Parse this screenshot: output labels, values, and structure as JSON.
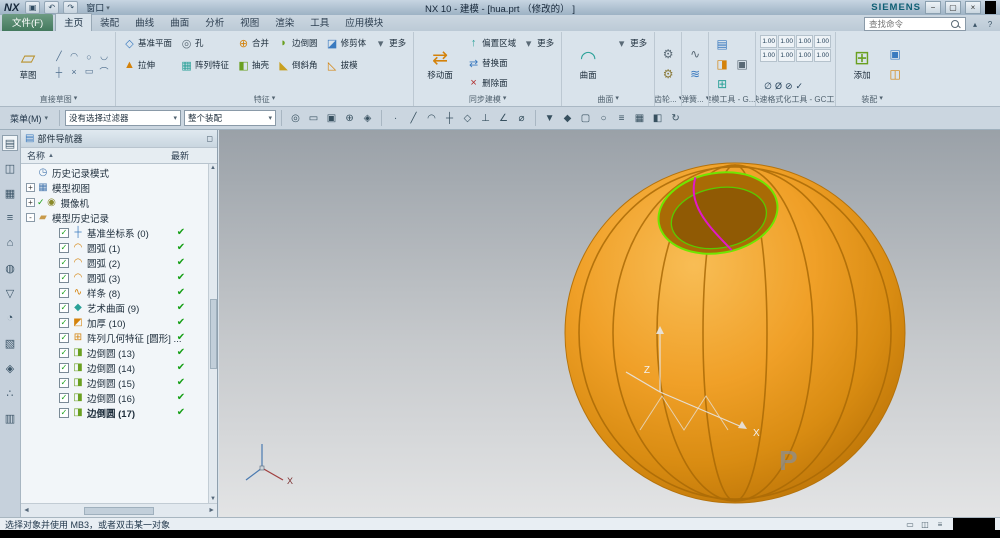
{
  "ui": {
    "caret_down": "▾",
    "caret_up": "▲",
    "arrow_left": "◄",
    "arrow_right": "►",
    "scroll_up": "▲",
    "scroll_down": "▼"
  },
  "title_bar": {
    "logo": "NX",
    "icons": [
      "▣",
      "↶",
      "↷"
    ],
    "window_menu": "窗口",
    "title": "NX 10 - 建模 - [hua.prt （修改的） ]",
    "brand": "SIEMENS",
    "win_buttons": [
      "−",
      "▢",
      "×"
    ]
  },
  "tabs": {
    "file": "文件(F)",
    "items": [
      {
        "label": "主页",
        "active": true
      },
      {
        "label": "装配"
      },
      {
        "label": "曲线"
      },
      {
        "label": "曲面"
      },
      {
        "label": "分析"
      },
      {
        "label": "视图"
      },
      {
        "label": "渲染"
      },
      {
        "label": "工具"
      },
      {
        "label": "应用模块"
      }
    ],
    "search_placeholder": "查找命令",
    "right_icons": [
      "▴",
      "?"
    ]
  },
  "ribbon": {
    "sketch": {
      "label": "直接草图",
      "big": {
        "label": "草图",
        "glyph": "▱",
        "color": "#b8902a"
      },
      "mini": [
        "╱",
        "◠",
        "○",
        "◡",
        "┼",
        "×",
        "▭",
        "⌒"
      ]
    },
    "feature": {
      "label": "特征",
      "buttons": [
        {
          "label": "基准平面",
          "glyph": "◇",
          "color": "#3a7abf"
        },
        {
          "label": "拉伸",
          "glyph": "▲",
          "color": "#d4820a"
        },
        {
          "label": "孔",
          "glyph": "◎",
          "color": "#5a6a76"
        },
        {
          "label": "阵列特征",
          "glyph": "▦",
          "color": "#2aa198"
        },
        {
          "label": "合并",
          "glyph": "⊕",
          "color": "#d4820a"
        },
        {
          "label": "抽壳",
          "glyph": "◧",
          "color": "#6aa020"
        },
        {
          "label": "边倒圆",
          "glyph": "◗",
          "color": "#6aa020"
        },
        {
          "label": "倒斜角",
          "glyph": "◣",
          "color": "#c8a020"
        },
        {
          "label": "修剪体",
          "glyph": "◪",
          "color": "#3a7abf"
        },
        {
          "label": "拔模",
          "glyph": "◺",
          "color": "#d4820a"
        },
        {
          "label": "更多",
          "glyph": "▾",
          "color": "#5a6a76"
        }
      ]
    },
    "sync": {
      "label": "同步建模",
      "big": {
        "label": "移动面",
        "glyph": "⇄",
        "color": "#d4820a"
      },
      "buttons": [
        {
          "label": "偏置区域",
          "glyph": "↑",
          "color": "#2aa198"
        },
        {
          "label": "替换面",
          "glyph": "⇄",
          "color": "#3a7abf"
        },
        {
          "label": "删除面",
          "glyph": "×",
          "color": "#b03030"
        },
        {
          "label": "更多",
          "glyph": "▾",
          "color": "#5a6a76"
        }
      ]
    },
    "surface": {
      "label": "曲面",
      "big": {
        "label": "曲面",
        "glyph": "◠",
        "color": "#2aa198"
      },
      "buttons": [
        {
          "label": "更多",
          "glyph": "▾",
          "color": "#5a6a76"
        }
      ]
    },
    "gear": {
      "label": "齿轮...",
      "icons": [
        {
          "glyph": "⚙",
          "color": "#5a6a76"
        },
        {
          "glyph": "⚙",
          "color": "#8a7a3a"
        }
      ]
    },
    "spring": {
      "label": "弹簧...",
      "icons": [
        {
          "glyph": "∿",
          "color": "#5a6a76"
        },
        {
          "glyph": "≋",
          "color": "#3a7abf"
        }
      ]
    },
    "gctools": {
      "label": "建模工具 - G...",
      "icons": [
        {
          "glyph": "▤",
          "color": "#3a7abf"
        },
        {
          "glyph": "◨",
          "color": "#d4820a"
        },
        {
          "glyph": "⊞",
          "color": "#2aa198"
        },
        {
          "glyph": "▣",
          "color": "#5a6a76"
        }
      ]
    },
    "dims": {
      "label": "尺寸快速格式化工具 - GC工具箱",
      "cells": [
        "1.00",
        "1.00",
        "1.00",
        "1.00",
        "1.00",
        "1.00",
        "1.00",
        "1.00"
      ],
      "syms": [
        "∅",
        "Ø",
        "⊘",
        "✓"
      ]
    },
    "asm": {
      "label": "装配",
      "big": {
        "label": "添加",
        "glyph": "⊞",
        "color": "#6aa020"
      },
      "icons": [
        {
          "glyph": "▣",
          "color": "#3a7abf"
        },
        {
          "glyph": "◫",
          "color": "#d4820a"
        }
      ]
    }
  },
  "selbar": {
    "menu": "菜单(M)",
    "filter": "没有选择过滤器",
    "scope": "整个装配",
    "c1": [
      "◎",
      "▭",
      "▣",
      "⊕",
      "◈"
    ],
    "c2": [
      "∙",
      "╱",
      "◠",
      "┼",
      "◇",
      "⊥",
      "∠",
      "⌀"
    ],
    "c3": [
      "▼",
      "◆",
      "▢",
      "○",
      "≡",
      "▦",
      "◧",
      "↻"
    ]
  },
  "leftstrip": {
    "icons": [
      {
        "glyph": "▤",
        "active": true
      },
      {
        "glyph": "◫"
      },
      {
        "glyph": "▦"
      },
      {
        "glyph": "≡"
      },
      {
        "glyph": "⌂"
      },
      {
        "glyph": "◍"
      },
      {
        "glyph": "▽"
      },
      {
        "glyph": "◔"
      },
      {
        "glyph": "▧"
      },
      {
        "glyph": "◈"
      },
      {
        "glyph": "∴"
      },
      {
        "glyph": "▥"
      }
    ]
  },
  "navigator": {
    "title": "部件导航器",
    "title_btn": "◻",
    "col_name": "名称",
    "col_sort": "▲",
    "col_latest": "最新",
    "check_glyph": "✓",
    "items": [
      {
        "glyph": "◷",
        "color": "#4a7ab0",
        "label": "历史记录模式"
      },
      {
        "expander": "+",
        "glyph": "▦",
        "color": "#4a7ab0",
        "label": "模型视图"
      },
      {
        "expander": "+",
        "precheck": true,
        "glyph": "◉",
        "color": "#8a8a2a",
        "label": "摄像机"
      },
      {
        "expander": "-",
        "glyph": "▰",
        "color": "#c89a4a",
        "label": "模型历史记录"
      },
      {
        "level": 1,
        "checkbox": true,
        "glyph": "┼",
        "color": "#3a7abf",
        "label": "基准坐标系 (0)",
        "latest": "✔"
      },
      {
        "level": 1,
        "checkbox": true,
        "glyph": "◠",
        "color": "#d4820a",
        "label": "圆弧 (1)",
        "latest": "✔"
      },
      {
        "level": 1,
        "checkbox": true,
        "glyph": "◠",
        "color": "#d4820a",
        "label": "圆弧 (2)",
        "latest": "✔"
      },
      {
        "level": 1,
        "checkbox": true,
        "glyph": "◠",
        "color": "#d4820a",
        "label": "圆弧 (3)",
        "latest": "✔"
      },
      {
        "level": 1,
        "checkbox": true,
        "glyph": "∿",
        "color": "#d4820a",
        "label": "样条 (8)",
        "latest": "✔"
      },
      {
        "level": 1,
        "checkbox": true,
        "glyph": "◆",
        "color": "#2aa198",
        "label": "艺术曲面 (9)",
        "latest": "✔"
      },
      {
        "level": 1,
        "checkbox": true,
        "glyph": "◩",
        "color": "#d4820a",
        "label": "加厚 (10)",
        "latest": "✔"
      },
      {
        "level": 1,
        "checkbox": true,
        "glyph": "⊞",
        "color": "#d4820a",
        "label": "阵列几何特征 [圆形] ...",
        "latest": "✔"
      },
      {
        "level": 1,
        "checkbox": true,
        "glyph": "◨",
        "color": "#6aa020",
        "label": "边倒圆 (13)",
        "latest": "✔"
      },
      {
        "level": 1,
        "checkbox": true,
        "glyph": "◨",
        "color": "#6aa020",
        "label": "边倒圆 (14)",
        "latest": "✔"
      },
      {
        "level": 1,
        "checkbox": true,
        "glyph": "◨",
        "color": "#6aa020",
        "label": "边倒圆 (15)",
        "latest": "✔"
      },
      {
        "level": 1,
        "checkbox": true,
        "glyph": "◨",
        "color": "#6aa020",
        "label": "边倒圆 (16)",
        "latest": "✔"
      },
      {
        "level": 1,
        "checkbox": true,
        "glyph": "◨",
        "color": "#6aa020",
        "label": "边倒圆 (17)",
        "latest": "✔",
        "bold": true
      }
    ]
  },
  "viewport": {
    "z_label": "Z",
    "x_label": "X",
    "triad_x_label": "X",
    "watermark": "P",
    "sphere_color": "#ef9f24",
    "seam_color": "#aa6a06",
    "hole_edge_color": "#6fe600",
    "spline_color": "#e218c8"
  },
  "statusbar": {
    "text": "选择对象并使用 MB3，或者双击某一对象",
    "icons": [
      "▭",
      "◫",
      "≡"
    ]
  }
}
